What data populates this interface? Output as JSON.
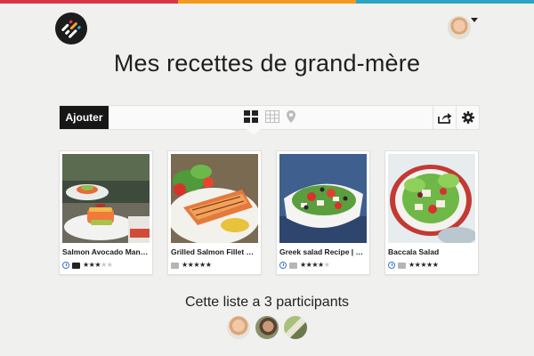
{
  "brand": {
    "logo_icon": "app-logo-icon",
    "stripe_colors": [
      "#d8344a",
      "#f39a1e",
      "#2aa4c2"
    ]
  },
  "header": {
    "title": "Mes recettes de grand-mère"
  },
  "toolbar": {
    "add_label": "Ajouter",
    "views": [
      "grid-view-icon",
      "table-view-icon",
      "map-view-icon"
    ],
    "actions": [
      "share-icon",
      "gear-icon"
    ]
  },
  "recipes": [
    {
      "title": "Salmon Avocado Mango ...",
      "has_time": true,
      "comment_style": "dark",
      "rating": 3,
      "max_rating": 5
    },
    {
      "title": "Grilled Salmon Fillet Reci...",
      "has_time": false,
      "comment_style": "grey",
      "rating": 5,
      "max_rating": 5
    },
    {
      "title": "Greek salad Recipe | deli...",
      "has_time": true,
      "comment_style": "grey",
      "rating": 4,
      "max_rating": 5
    },
    {
      "title": "Baccala Salad",
      "has_time": true,
      "comment_style": "grey",
      "rating": 5,
      "max_rating": 5
    }
  ],
  "participants": {
    "label": "Cette liste a 3 participants",
    "count": 3
  }
}
